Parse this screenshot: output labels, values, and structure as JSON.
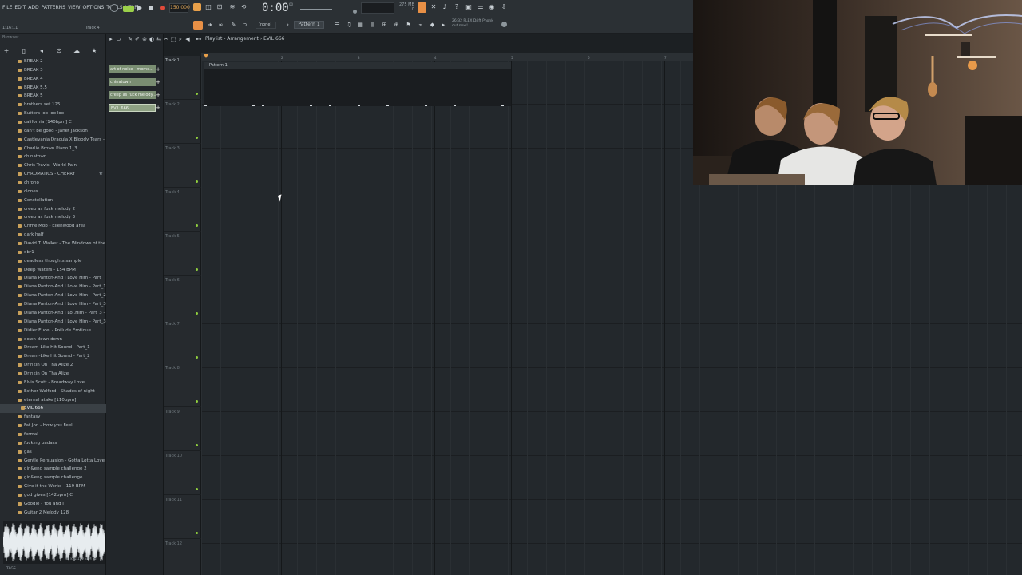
{
  "menu": [
    "FILE",
    "EDIT",
    "ADD",
    "PATTERNS",
    "VIEW",
    "OPTIONS",
    "TOOLS",
    "HELP"
  ],
  "hint_time": "1:16:11",
  "track_label": "Track 4",
  "tempo": "150.000",
  "time": "0:00",
  "time_sub": "00",
  "cpu_mb": [
    "275 MB",
    "0"
  ],
  "snap": "(none)",
  "pattern_selector": "Pattern 1",
  "news": [
    "26:32 FLEX Drift Phonk",
    "out now!"
  ],
  "playlist_title": "Playlist - Arrangement › EVIL 666",
  "browser": {
    "title": "Browser",
    "items": [
      "BREAK 2",
      "BREAK 3",
      "BREAK 4",
      "BREAK 5.5",
      "BREAK 5",
      "brothers set 125",
      "Butters loo loo loo",
      "california [140bpm] C",
      "can't be good - Janet Jackson",
      "Castlevania Dracula X Bloody Tears - Part_1",
      "Charlie Brown Piano 1_3",
      "chinatown",
      "Chris Travis - World Pain",
      "CHROMATICS - CHERRY",
      "chrono",
      "clones",
      "Constellation",
      "creep as fuck melody 2",
      "creep as fuck melody 3",
      "Crime Mob - Ellenwood area",
      "dark half",
      "David T. Walker - The Windows of the World",
      "dbr1",
      "deadless thoughts sample",
      "Deep Waters - 154 BPM",
      "Diana Panton-And I Love Him - Part",
      "Diana Panton-And I Love Him - Part_1",
      "Diana Panton-And I Love Him - Part_2",
      "Diana Panton-And I Love Him - Part_3 - Part",
      "Diana Panton-And I Lo..Him - Part_3 - Part_1",
      "Diana Panton-And I Love Him - Part_3",
      "Didier Eucel - Prélude Erotique",
      "down down down",
      "Dream-Like Hit Sound - Part_1",
      "Dream-Like Hit Sound - Part_2",
      "Drinkin On Tha Alize 2",
      "Drinkin On Tha Alize",
      "Elvis Scott - Broadway Love",
      "Esther Walford - Shades of night",
      "eternal atake [110bpm]",
      "EVIL 666",
      "fantasy",
      "Fat Jon - How you Feel",
      "formal",
      "fucking badass",
      "gas",
      "Gentle Persuasion - Gotta Lotta Love",
      "gin&eng sample challenge 2",
      "gin&eng sample challenge",
      "Give it the Works - 119 BPM",
      "god gives [142bpm] C",
      "Goodie - You and I",
      "Guitar 2 Melody 128"
    ],
    "selected_index": 40,
    "starred_index": 13,
    "wave_info": "48 kHz 130 BPM 32",
    "tags_label": "TAGS"
  },
  "picker": [
    "art of noise - mome...",
    "chinatown",
    "creep as fuck melody...",
    "EVIL 666"
  ],
  "tracks": [
    "Track 1",
    "Track 2",
    "Track 3",
    "Track 4",
    "Track 5",
    "Track 6",
    "Track 7",
    "Track 8",
    "Track 9",
    "Track 10",
    "Track 11",
    "Track 12"
  ],
  "ruler": [
    "2",
    "3",
    "4",
    "5",
    "6",
    "7"
  ],
  "clip_label": "Pattern 1"
}
